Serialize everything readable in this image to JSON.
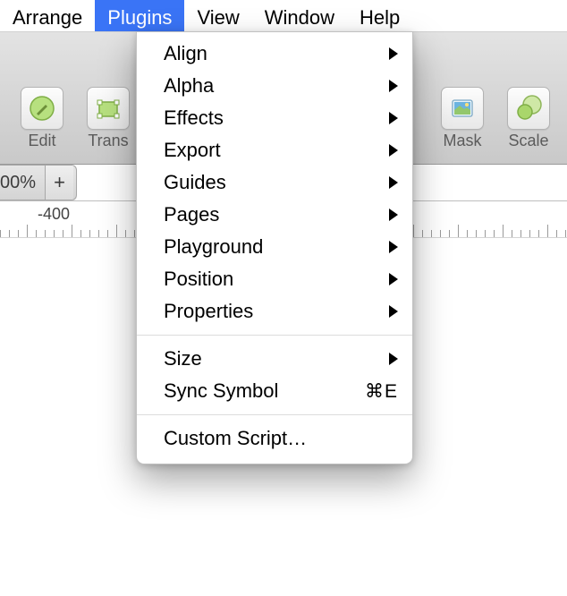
{
  "menubar": {
    "items": [
      {
        "label": "Arrange",
        "active": false
      },
      {
        "label": "Plugins",
        "active": true
      },
      {
        "label": "View",
        "active": false
      },
      {
        "label": "Window",
        "active": false
      },
      {
        "label": "Help",
        "active": false
      }
    ]
  },
  "toolbar": {
    "items": [
      {
        "label": "Edit",
        "icon": "pencil-circle-icon"
      },
      {
        "label": "Transform",
        "label_short": "Trans",
        "icon": "transform-icon"
      },
      {
        "label": "Mask",
        "icon": "image-icon"
      },
      {
        "label": "Scale",
        "icon": "scale-icon"
      }
    ]
  },
  "zoom": {
    "value": "00%",
    "plus": "+"
  },
  "ruler": {
    "value": "-400"
  },
  "plugins_menu": {
    "groups": [
      [
        {
          "label": "Align",
          "submenu": true
        },
        {
          "label": "Alpha",
          "submenu": true
        },
        {
          "label": "Effects",
          "submenu": true
        },
        {
          "label": "Export",
          "submenu": true
        },
        {
          "label": "Guides",
          "submenu": true
        },
        {
          "label": "Pages",
          "submenu": true
        },
        {
          "label": "Playground",
          "submenu": true
        },
        {
          "label": "Position",
          "submenu": true
        },
        {
          "label": "Properties",
          "submenu": true
        }
      ],
      [
        {
          "label": "Size",
          "submenu": true
        },
        {
          "label": "Sync Symbol",
          "submenu": false,
          "shortcut": "⌘E"
        }
      ],
      [
        {
          "label": "Custom Script…",
          "submenu": false
        }
      ]
    ]
  }
}
